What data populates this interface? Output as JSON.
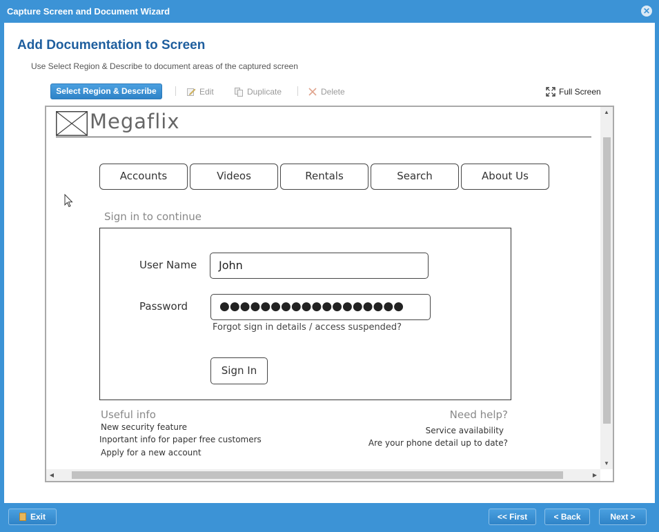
{
  "window": {
    "title": "Capture Screen and Document Wizard",
    "close_glyph": "✕"
  },
  "page": {
    "heading": "Add Documentation to Screen",
    "subheading": "Use Select Region & Describe to document areas of the captured screen"
  },
  "toolbar": {
    "select_label": "Select Region & Describe",
    "edit_label": "Edit",
    "duplicate_label": "Duplicate",
    "delete_label": "Delete",
    "fullscreen_label": "Full Screen",
    "icons": {
      "edit": "edit-icon",
      "duplicate": "duplicate-icon",
      "delete": "delete-icon",
      "fullscreen": "fullscreen-icon"
    }
  },
  "captured_screen": {
    "brand": "Megaflix",
    "nav": [
      "Accounts",
      "Videos",
      "Rentals",
      "Search",
      "About Us"
    ],
    "signin_caption": "Sign in to continue",
    "username_label": "User Name",
    "username_value": "John",
    "password_label": "Password",
    "password_value": "●●●●●●●●●●●●●●●●●●",
    "forgot_text": "Forgot sign in details / access suspended?",
    "signin_button": "Sign In",
    "useful_info": {
      "title": "Useful info",
      "links": [
        "New security feature",
        "Inportant info for paper free customers",
        "Apply for a new account"
      ]
    },
    "need_help": {
      "title": "Need help?",
      "links": [
        "Service availability",
        "Are your phone detail up to date?"
      ]
    }
  },
  "footer": {
    "exit_label": "Exit",
    "first_label": "<< First",
    "back_label": "< Back",
    "next_label": "Next >"
  },
  "colors": {
    "chrome_blue": "#3c93d6",
    "heading_blue": "#1e5e9e"
  }
}
